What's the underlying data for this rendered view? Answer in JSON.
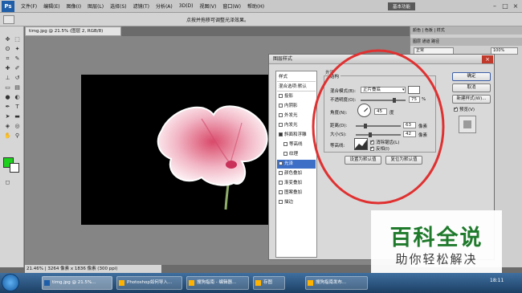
{
  "menubar": {
    "logo": "Ps",
    "items": [
      "文件(F)",
      "编辑(E)",
      "图像(I)",
      "图层(L)",
      "选择(S)",
      "滤镜(T)",
      "分析(A)",
      "3D(D)",
      "视图(V)",
      "窗口(W)",
      "帮助(H)"
    ],
    "essentials": "基本功能",
    "win_min": "–",
    "win_max": "□",
    "win_close": "×"
  },
  "optbar": {
    "hint": "点按并拖移可调整光泽效果。"
  },
  "document": {
    "tab": "timg.jpg @ 21.5% (图层 2, RGB/8)",
    "status": "21.46%  |  3264 像素 x 1836 像素 (300 ppi)"
  },
  "rightpanel": {
    "tabs": "颜色 | 色板 | 样式",
    "layers_tabs": "图层  通道  路径",
    "blend": "正常",
    "opacity": "100%"
  },
  "dialog": {
    "title": "图层样式",
    "close": "×",
    "style_list": [
      {
        "label": "样式",
        "type": "hdr"
      },
      {
        "label": "混合选项:默认",
        "type": "hdr"
      },
      {
        "label": "投影",
        "type": "item",
        "checked": false
      },
      {
        "label": "内阴影",
        "type": "item",
        "checked": false
      },
      {
        "label": "外发光",
        "type": "item",
        "checked": false
      },
      {
        "label": "内发光",
        "type": "item",
        "checked": false
      },
      {
        "label": "斜面和浮雕",
        "type": "item",
        "checked": true
      },
      {
        "label": "等高线",
        "type": "sub",
        "checked": false
      },
      {
        "label": "纹理",
        "type": "sub",
        "checked": false
      },
      {
        "label": "光泽",
        "type": "item",
        "checked": true,
        "selected": true
      },
      {
        "label": "颜色叠加",
        "type": "item",
        "checked": false
      },
      {
        "label": "渐变叠加",
        "type": "item",
        "checked": false
      },
      {
        "label": "图案叠加",
        "type": "item",
        "checked": false
      },
      {
        "label": "描边",
        "type": "item",
        "checked": false
      }
    ],
    "section_title": "光泽",
    "group_title": "结构",
    "blend_mode_label": "混合模式(B):",
    "blend_mode_value": "正片叠底",
    "opacity_label": "不透明度(O):",
    "opacity_value": "75",
    "opacity_unit": "%",
    "angle_label": "角度(N):",
    "angle_value": "45",
    "angle_unit": "度",
    "distance_label": "距离(D):",
    "distance_value": "63",
    "distance_unit": "像素",
    "size_label": "大小(S):",
    "size_value": "42",
    "size_unit": "像素",
    "contour_label": "等高线:",
    "antialias_label": "消除锯齿(L)",
    "invert_label": "反相(I)",
    "make_default": "设置为默认值",
    "reset_default": "复位为默认值",
    "ok": "确定",
    "cancel": "取消",
    "new_style": "新建样式(W)...",
    "preview": "预览(V)"
  },
  "watermark": {
    "title": "百科全说",
    "subtitle": "助你轻松解决"
  },
  "taskbar": {
    "tasks": [
      "timg.jpg @ 21.5%...",
      "Photoshop如何导入...",
      "搜狗指南 - 编辑器...",
      "存图",
      "搜狗指南发布..."
    ],
    "clock": "18:11"
  },
  "colors": {
    "foreground": "#1cd21c",
    "background": "#ffffff",
    "annotation_circle": "#e03131"
  }
}
